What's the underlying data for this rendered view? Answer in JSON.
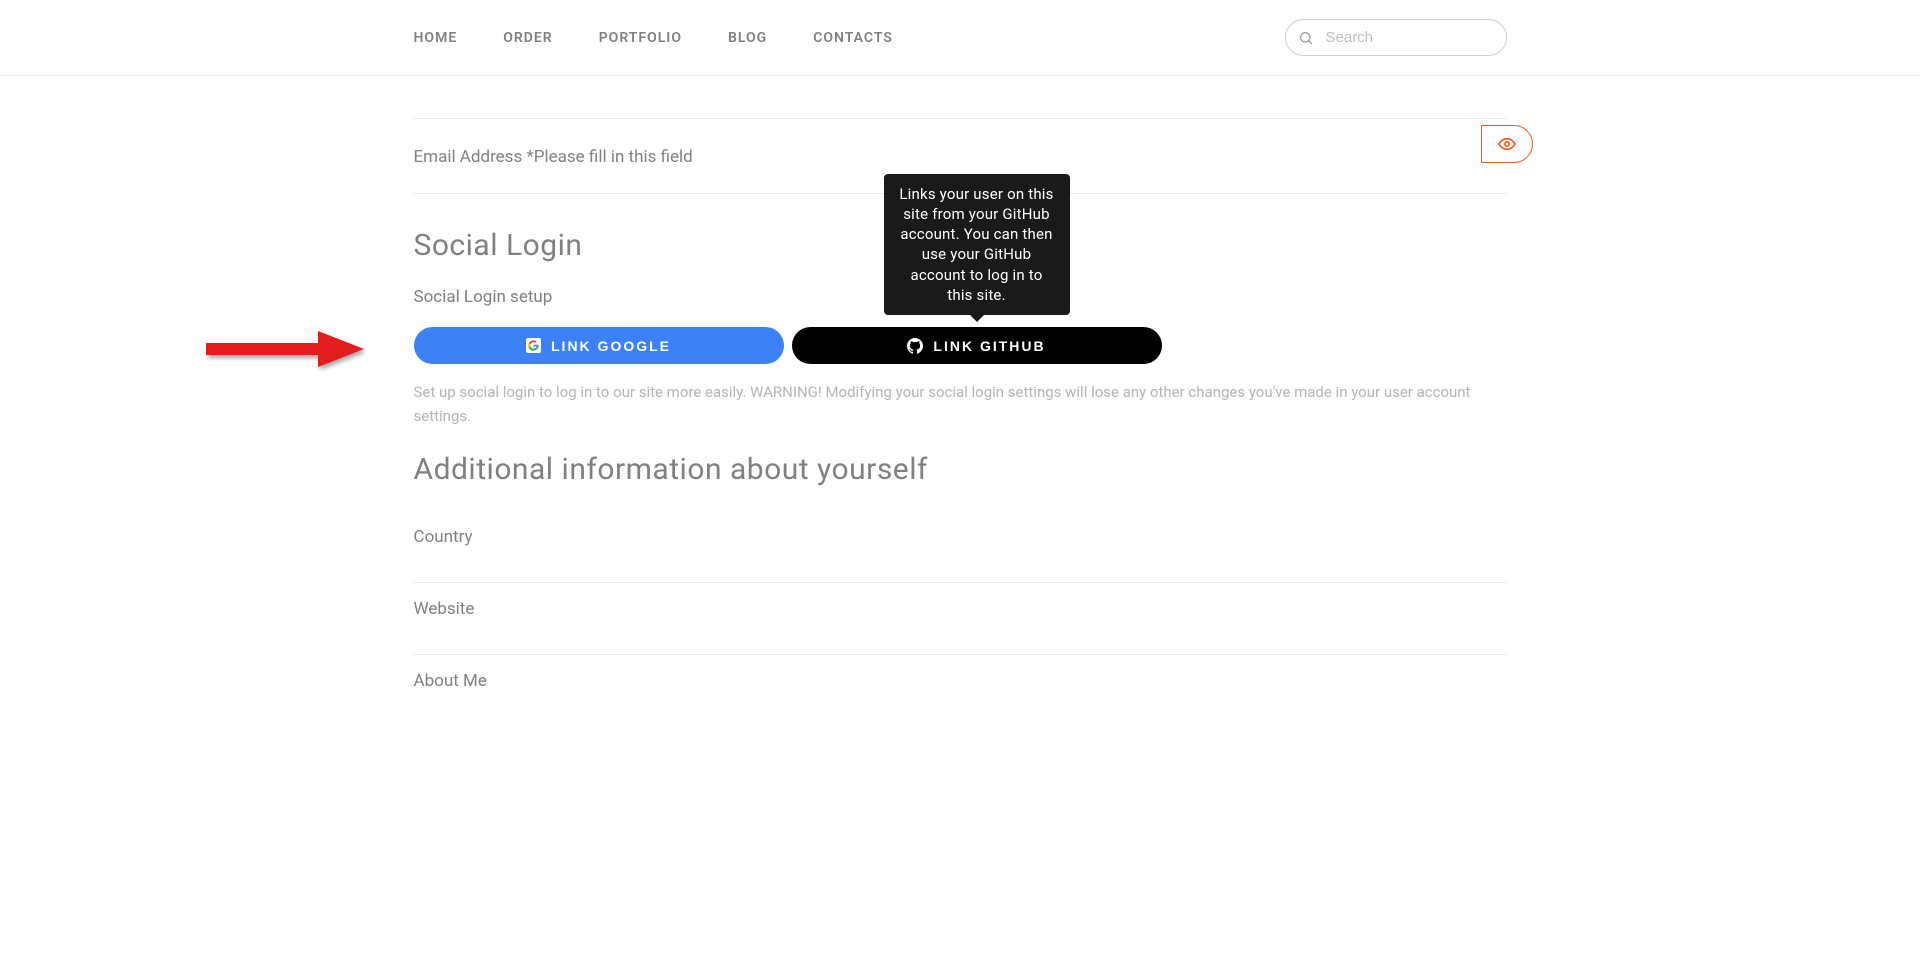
{
  "nav": {
    "items": [
      "HOME",
      "ORDER",
      "PORTFOLIO",
      "BLOG",
      "CONTACTS"
    ]
  },
  "search": {
    "placeholder": "Search"
  },
  "email_section": {
    "label": "Email Address *",
    "error": "Please fill in this field"
  },
  "social_login": {
    "title": "Social Login",
    "subtitle": "Social Login setup",
    "google_button": "LINK GOOGLE",
    "github_button": "LINK GITHUB",
    "tooltip": "Links your user on this site from your GitHub account. You can then use your GitHub account to log in to this site.",
    "help_text": "Set up social login to log in to our site more easily. WARNING! Modifying your social login settings will lose any other changes you've made in your user account settings."
  },
  "additional_info": {
    "title": "Additional information about yourself",
    "fields": {
      "country": "Country",
      "website": "Website",
      "about_me": "About Me"
    }
  }
}
